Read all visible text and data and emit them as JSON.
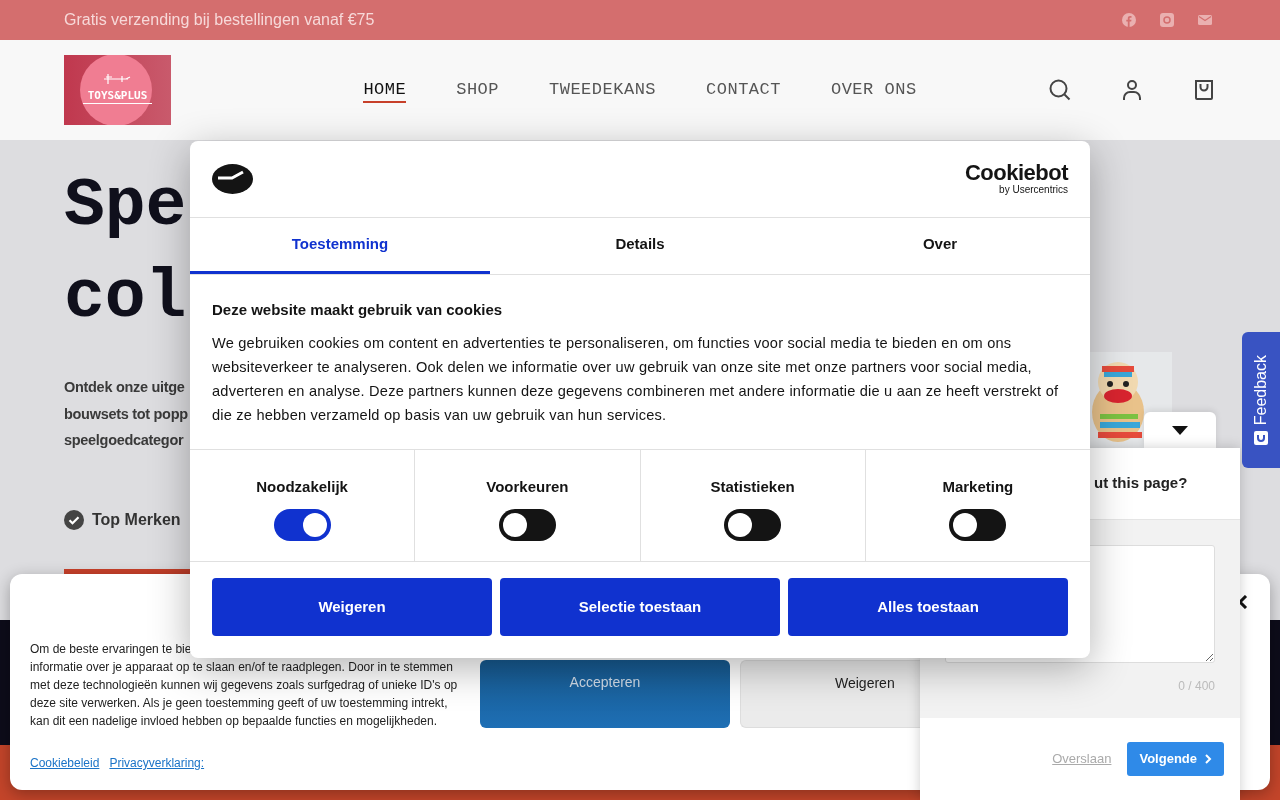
{
  "top_bar": {
    "text": "Gratis verzending bij bestellingen vanaf €75"
  },
  "header": {
    "logo_text": "TOYS&PLUS",
    "nav": [
      {
        "label": "HOME",
        "selected": true
      },
      {
        "label": "SHOP",
        "selected": false
      },
      {
        "label": "TWEEDEKANS",
        "selected": false
      },
      {
        "label": "CONTACT",
        "selected": false
      },
      {
        "label": "OVER ONS",
        "selected": false
      }
    ]
  },
  "hero": {
    "title_lines": [
      "Spe",
      "col"
    ],
    "intro_lines": [
      "Ontdek onze uitge",
      "bouwsets tot popp",
      "speelgoedcategor"
    ],
    "feature": "Top Merken",
    "picture": {
      "kind": "picture"
    }
  },
  "cookie_banner": {
    "text_lines": [
      "Om de beste ervaringen te bie",
      "informatie over je apparaat op te slaan en/of te raadplegen. Door in te stemmen",
      "met deze technologieën kunnen wij gegevens zoals surfgedrag of unieke ID's op",
      "deze site verwerken. Als je geen toestemming geeft of uw toestemming intrekt,",
      "kan dit een nadelige invloed hebben op bepaalde functies en mogelijkheden."
    ],
    "links": [
      "Cookiebeleid",
      "Privacyverklaring:"
    ],
    "buttons": [
      {
        "label": "Accepteren",
        "kind": "primary"
      },
      {
        "label": "Weigeren",
        "kind": "secondary"
      }
    ]
  },
  "feedback": {
    "tab_label": "Feedback",
    "question": "ut this page?",
    "counter": "0 / 400",
    "skip": "Overslaan",
    "next": "Volgende"
  },
  "cookiebot": {
    "brand": "Cookiebot",
    "brand_sub": "by Usercentrics",
    "tabs": [
      {
        "label": "Toestemming",
        "selected": true
      },
      {
        "label": "Details",
        "selected": false
      },
      {
        "label": "Over",
        "selected": false
      }
    ],
    "title": "Deze website maakt gebruik van cookies",
    "text": "We gebruiken cookies om content en advertenties te personaliseren, om functies voor social media te bieden en om ons websiteverkeer te analyseren. Ook delen we informatie over uw gebruik van onze site met onze partners voor social media, adverteren en analyse. Deze partners kunnen deze gegevens combineren met andere informatie die u aan ze heeft verstrekt of die ze hebben verzameld op basis van uw gebruik van hun services.",
    "toggles": [
      {
        "label": "Noodzakelijk",
        "on": true
      },
      {
        "label": "Voorkeuren",
        "on": false
      },
      {
        "label": "Statistieken",
        "on": false
      },
      {
        "label": "Marketing",
        "on": false
      }
    ],
    "buttons": [
      "Weigeren",
      "Selectie toestaan",
      "Alles toestaan"
    ]
  }
}
